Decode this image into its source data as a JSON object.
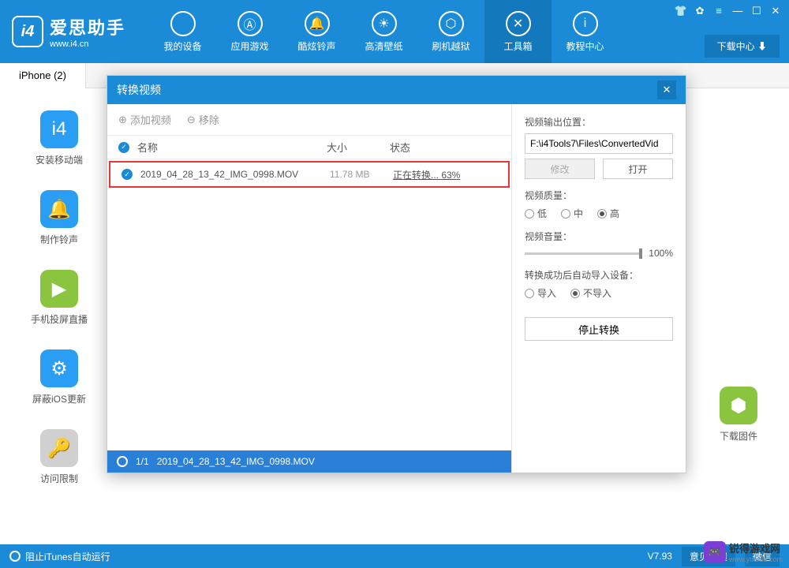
{
  "header": {
    "logo_title": "爱思助手",
    "logo_sub": "www.i4.cn",
    "nav": [
      {
        "label": "我的设备"
      },
      {
        "label": "应用游戏"
      },
      {
        "label": "酷炫铃声"
      },
      {
        "label": "高清壁纸"
      },
      {
        "label": "刷机越狱"
      },
      {
        "label": "工具箱"
      },
      {
        "label": "教程中心"
      }
    ],
    "download_center": "下载中心"
  },
  "tab": {
    "label": "iPhone (2)"
  },
  "sidebar": [
    {
      "label": "安装移动端"
    },
    {
      "label": "制作铃声"
    },
    {
      "label": "手机投屏直播"
    },
    {
      "label": "屏蔽iOS更新"
    },
    {
      "label": "访问限制"
    }
  ],
  "rtool": {
    "label": "下载固件"
  },
  "dialog": {
    "title": "转换视频",
    "add_video": "添加视频",
    "remove": "移除",
    "th_name": "名称",
    "th_size": "大小",
    "th_status": "状态",
    "row": {
      "name": "2019_04_28_13_42_IMG_0998.MOV",
      "size": "11.78 MB",
      "status": "正在转换... 63%"
    },
    "progress": {
      "count": "1/1",
      "file": "2019_04_28_13_42_IMG_0998.MOV"
    },
    "right": {
      "output_label": "视频输出位置：",
      "output_path": "F:\\i4Tools7\\Files\\ConvertedVid",
      "modify": "修改",
      "open": "打开",
      "quality_label": "视频质量：",
      "q_low": "低",
      "q_mid": "中",
      "q_high": "高",
      "volume_label": "视频音量：",
      "volume_value": "100%",
      "import_label": "转换成功后自动导入设备：",
      "import_yes": "导入",
      "import_no": "不导入",
      "stop": "停止转换"
    }
  },
  "bottombar": {
    "itunes": "阻止iTunes自动运行",
    "version": "V7.93",
    "feedback": "意见反馈",
    "wechat": "微信"
  },
  "watermark": {
    "title": "锐得游戏网",
    "sub": "www.ytruida.com"
  }
}
